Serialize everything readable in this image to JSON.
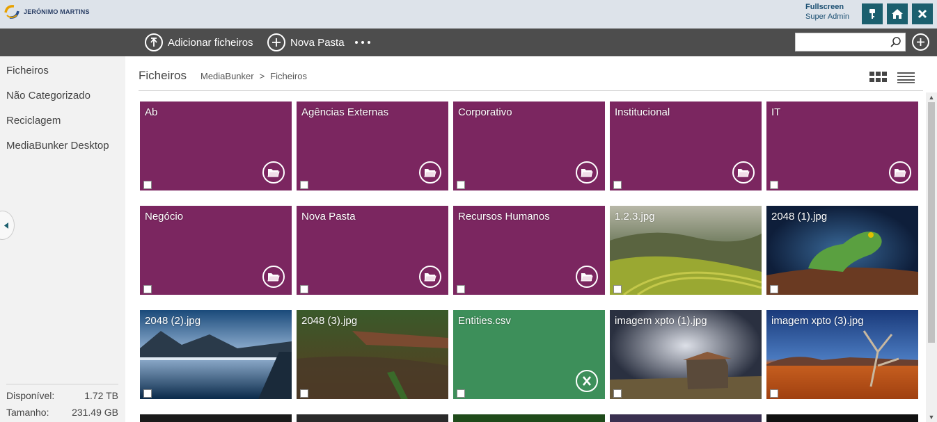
{
  "header": {
    "logo_text": "JERÓNIMO MARTINS",
    "fullscreen_label": "Fullscreen",
    "user_role": "Super Admin",
    "colors": {
      "button_bg": "#1b5f6e",
      "header_bg": "#dde3ea"
    }
  },
  "toolbar": {
    "add_files_label": "Adicionar ficheiros",
    "new_folder_label": "Nova Pasta",
    "search_placeholder": ""
  },
  "sidebar": {
    "items": [
      {
        "label": "Ficheiros"
      },
      {
        "label": "Não Categorizado"
      },
      {
        "label": "Reciclagem"
      },
      {
        "label": "MediaBunker Desktop"
      }
    ],
    "storage": {
      "available_label": "Disponível:",
      "available_value": "1.72 TB",
      "size_label": "Tamanho:",
      "size_value": "231.49 GB"
    }
  },
  "main": {
    "title": "Ficheiros",
    "breadcrumb": {
      "root": "MediaBunker",
      "separator": ">",
      "current": "Ficheiros"
    },
    "colors": {
      "folder": "#7b2660",
      "csv": "#3d8f5a"
    },
    "tiles": [
      {
        "label": "Ab",
        "type": "folder"
      },
      {
        "label": "Agências Externas",
        "type": "folder"
      },
      {
        "label": "Corporativo",
        "type": "folder"
      },
      {
        "label": "Institucional",
        "type": "folder"
      },
      {
        "label": "IT",
        "type": "folder"
      },
      {
        "label": "Negócio",
        "type": "folder"
      },
      {
        "label": "Nova Pasta",
        "type": "folder"
      },
      {
        "label": "Recursos Humanos",
        "type": "folder"
      },
      {
        "label": "1.2.3.jpg",
        "type": "image"
      },
      {
        "label": "2048 (1).jpg",
        "type": "image"
      },
      {
        "label": "2048 (2).jpg",
        "type": "image"
      },
      {
        "label": "2048 (3).jpg",
        "type": "image"
      },
      {
        "label": "Entities.csv",
        "type": "csv"
      },
      {
        "label": "imagem xpto (1).jpg",
        "type": "image"
      },
      {
        "label": "imagem xpto (3).jpg",
        "type": "image"
      }
    ]
  }
}
